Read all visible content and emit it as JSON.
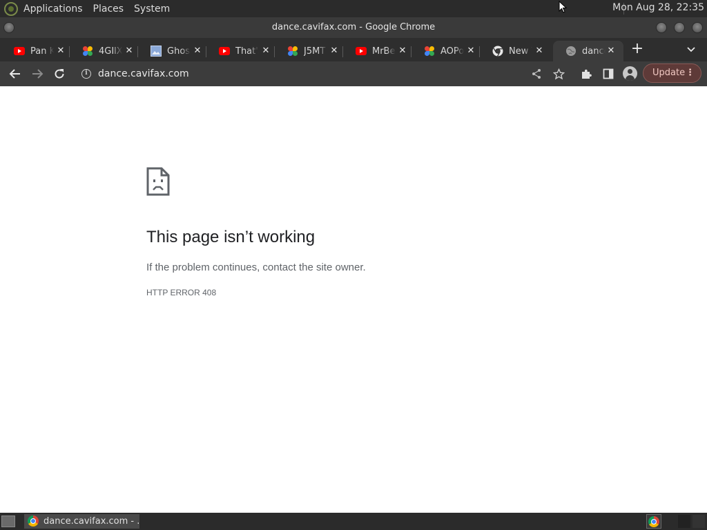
{
  "top_panel": {
    "menus": [
      "Applications",
      "Places",
      "System"
    ],
    "clock": "Mon Aug 28, 22:35"
  },
  "window": {
    "title": "dance.cavifax.com - Google Chrome"
  },
  "tabs": [
    {
      "title": "Pan K",
      "favicon": "youtube-icon"
    },
    {
      "title": "4GIlX",
      "favicon": "pinwheel-icon"
    },
    {
      "title": "Ghost",
      "favicon": "image-icon"
    },
    {
      "title": "That's",
      "favicon": "youtube-icon"
    },
    {
      "title": "J5MT",
      "favicon": "pinwheel-icon"
    },
    {
      "title": "MrBe",
      "favicon": "youtube-icon"
    },
    {
      "title": "AOPo",
      "favicon": "pinwheel-icon"
    },
    {
      "title": "New T",
      "favicon": "chrome-icon"
    },
    {
      "title": "dance",
      "favicon": "globe-icon",
      "active": true
    }
  ],
  "toolbar": {
    "url": "dance.cavifax.com",
    "update_label": "Update"
  },
  "error_page": {
    "title": "This page isn’t working",
    "subtitle": "If the problem continues, contact the site owner.",
    "code": "HTTP ERROR 408"
  },
  "taskbar": {
    "task_label": "dance.cavifax.com - ..."
  },
  "colors": {
    "chrome_dark": "#3c3c3c",
    "tabstrip": "#2e2e2e",
    "panel": "#2b2b2b",
    "update_bg": "#5e3a38",
    "error_text": "#202124",
    "muted_text": "#5f6368"
  }
}
